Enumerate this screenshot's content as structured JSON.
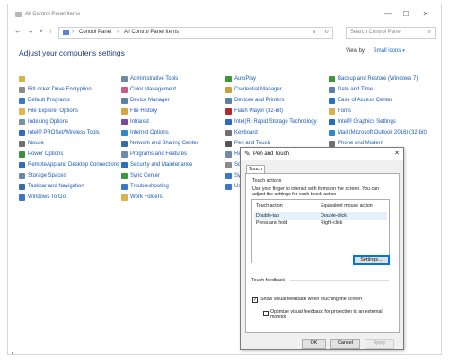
{
  "window": {
    "title": "All Control Panel Items",
    "controls": {
      "minimize": "—",
      "maximize": "☐",
      "close": "✕"
    }
  },
  "navigation": {
    "back": "←",
    "forward": "→",
    "recent": "∨",
    "up": "↑",
    "breadcrumb": [
      "Control Panel",
      "All Control Panel Items"
    ],
    "separator": "›",
    "dropdown": "∨",
    "refresh": "↻",
    "search_placeholder": "Search Control Panel",
    "search_icon": "⌕"
  },
  "header": {
    "title": "Adjust your computer's settings",
    "view_by_label": "View by:",
    "view_by_value": "Small icons",
    "view_by_arrow": "▾"
  },
  "items": {
    "col1": [
      {
        "label": "",
        "color": "#d8b24a"
      },
      {
        "label": "BitLocker Drive Encryption",
        "color": "#8a8a8a"
      },
      {
        "label": "Default Programs",
        "color": "#3a78c7"
      },
      {
        "label": "File Explorer Options",
        "color": "#e2b64c"
      },
      {
        "label": "Indexing Options",
        "color": "#7a8fa8"
      },
      {
        "label": "Intel® PROSet/Wireless Tools",
        "color": "#2a6cc0"
      },
      {
        "label": "Mouse",
        "color": "#707070"
      },
      {
        "label": "Power Options",
        "color": "#3f8f3f"
      },
      {
        "label": "RemoteApp and Desktop Connections",
        "color": "#2f6fbf"
      },
      {
        "label": "Storage Spaces",
        "color": "#6a86a8"
      },
      {
        "label": "Taskbar and Navigation",
        "color": "#3a6aa8"
      },
      {
        "label": "Windows To Go",
        "color": "#3a78c7"
      }
    ],
    "col2": [
      {
        "label": "Administrative Tools",
        "color": "#6f8aa6"
      },
      {
        "label": "Color Management",
        "color": "#c95a8a"
      },
      {
        "label": "Device Manager",
        "color": "#5a7fa8"
      },
      {
        "label": "File History",
        "color": "#d4a640"
      },
      {
        "label": "Infrared",
        "color": "#7a4aa0"
      },
      {
        "label": "Internet Options",
        "color": "#2f86c9"
      },
      {
        "label": "Network and Sharing Center",
        "color": "#3a6aa8"
      },
      {
        "label": "Programs and Features",
        "color": "#6f8aa6"
      },
      {
        "label": "Security and Maintenance",
        "color": "#2f6fbf"
      },
      {
        "label": "Sync Center",
        "color": "#3a9a3a"
      },
      {
        "label": "Troubleshooting",
        "color": "#3a78c7"
      },
      {
        "label": "Work Folders",
        "color": "#d8b24a"
      }
    ],
    "col3": [
      {
        "label": "AutoPlay",
        "color": "#3a9a3a"
      },
      {
        "label": "Credential Manager",
        "color": "#c9a040"
      },
      {
        "label": "Devices and Printers",
        "color": "#5a7fa8"
      },
      {
        "label": "Flash Player (32-bit)",
        "color": "#b02a2a"
      },
      {
        "label": "Intel(R) Rapid Storage Technology",
        "color": "#2a6cc0"
      },
      {
        "label": "Keyboard",
        "color": "#707070"
      },
      {
        "label": "Pen and Touch",
        "color": "#555555"
      },
      {
        "label": "Rec",
        "color": "#6f8aa6"
      },
      {
        "label": "Sou",
        "color": "#8a8a8a"
      },
      {
        "label": "Syst",
        "color": "#3a78c7"
      },
      {
        "label": "Use",
        "color": "#3a78c7"
      }
    ],
    "col4": [
      {
        "label": "Backup and Restore (Windows 7)",
        "color": "#3a9a3a"
      },
      {
        "label": "Date and Time",
        "color": "#5a7fa8"
      },
      {
        "label": "Ease of Access Center",
        "color": "#2f6fbf"
      },
      {
        "label": "Fonts",
        "color": "#d8b24a"
      },
      {
        "label": "Intel® Graphics Settings",
        "color": "#2a6cc0"
      },
      {
        "label": "Mail (Microsoft Outlook 2016) (32-bit)",
        "color": "#2f86c9"
      },
      {
        "label": "Phone and Modem",
        "color": "#707070"
      }
    ]
  },
  "dialog": {
    "title": "Pen and Touch",
    "icon": "✎",
    "close": "✕",
    "tab": "Touch",
    "touch_actions_heading": "Touch actions",
    "touch_actions_desc": [
      "Use your finger to interact with items on the screen. You can",
      "adjust the settings for each touch action"
    ],
    "table_headers": [
      "Touch action",
      "Equivalent mouse action"
    ],
    "table_rows": [
      {
        "action": "Double-tap",
        "mouse": "Double-click"
      },
      {
        "action": "Press and hold",
        "mouse": "Right-click"
      }
    ],
    "settings_button": "Settings...",
    "touch_feedback_heading": "Touch feedback",
    "show_feedback_label": "Show visual feedback when touching the screen",
    "show_feedback_checked": true,
    "check_mark": "✓",
    "optimize_label": [
      "Optimize visual feedback for projection to an external",
      "monitor"
    ],
    "optimize_checked": false,
    "ok": "OK",
    "cancel": "Cancel",
    "apply": "Apply"
  }
}
